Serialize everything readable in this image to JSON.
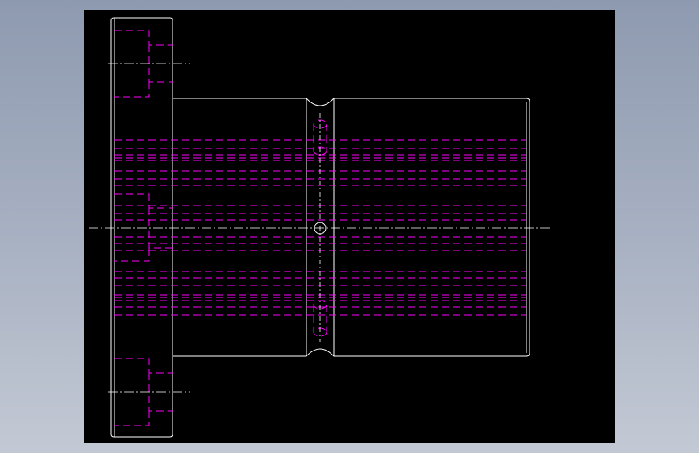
{
  "app": {
    "window_background": "gradient-gray-blue"
  },
  "drawing": {
    "view": "cad-part-front-view",
    "colors": {
      "canvas": "#000000",
      "outline": "#ffffff",
      "hidden": "#ff00ff",
      "centerline": "#ffffff"
    },
    "features": [
      "flange-outline",
      "hub-outline",
      "groove-notch-top",
      "groove-notch-bottom",
      "center-hole",
      "slot-hole-upper",
      "slot-hole-lower",
      "hidden-bore-lines",
      "flange-counterbore-pockets",
      "centerlines"
    ]
  }
}
